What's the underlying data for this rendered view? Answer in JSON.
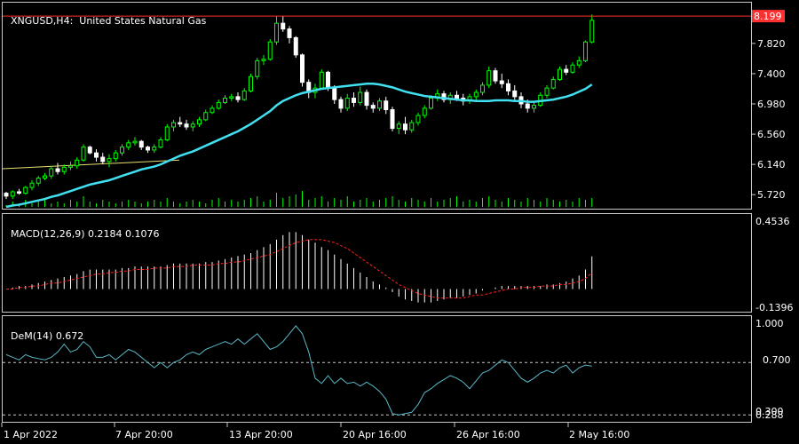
{
  "colors": {
    "background": "#000000",
    "frame": "#c8c8c8",
    "bull_candle": "#00ff00",
    "bear_candle": "#ffffff",
    "moving_average": "#40e0f0",
    "trendline": "#e8e070",
    "price_line": "#ff3030",
    "macd_signal": "#ff2020",
    "dem_line": "#5bb8c8",
    "level_lines": "#c8c8c8"
  },
  "main": {
    "symbol": "XNGUSD",
    "timeframe": "H4",
    "description": "United States Natural Gas",
    "current_price": "8.199",
    "price_ticks": [
      "7.820",
      "7.400",
      "6.980",
      "6.560",
      "6.140",
      "5.720"
    ]
  },
  "macd": {
    "name": "MACD(12,26,9)",
    "value_main": "0.2184",
    "value_signal": "0.1076",
    "scale_max": "0.4536",
    "scale_min": "-0.1396"
  },
  "dem": {
    "name": "DeM(14)",
    "value": "0.672",
    "scale_max": "1.000",
    "level_high": "0.700",
    "level_low": "0.300",
    "scale_min": "0.288"
  },
  "time_axis": [
    "1 Apr 2022",
    "7 Apr 20:00",
    "13 Apr 20:00",
    "20 Apr 16:00",
    "26 Apr 16:00",
    "2 May 16:00"
  ],
  "chart_data": [
    {
      "type": "candlestick",
      "title": "XNGUSD,H4: United States Natural Gas",
      "ylim": [
        5.55,
        8.25
      ],
      "candles": [
        [
          5.74,
          5.76,
          5.66,
          5.7
        ],
        [
          5.7,
          5.78,
          5.66,
          5.76
        ],
        [
          5.76,
          5.8,
          5.72,
          5.74
        ],
        [
          5.74,
          5.84,
          5.72,
          5.82
        ],
        [
          5.82,
          5.92,
          5.78,
          5.88
        ],
        [
          5.88,
          5.98,
          5.84,
          5.95
        ],
        [
          5.95,
          6.02,
          5.92,
          5.98
        ],
        [
          5.98,
          6.12,
          5.94,
          6.08
        ],
        [
          6.08,
          6.16,
          6.0,
          6.04
        ],
        [
          6.04,
          6.14,
          6.0,
          6.1
        ],
        [
          6.1,
          6.18,
          6.06,
          6.12
        ],
        [
          6.12,
          6.24,
          6.08,
          6.2
        ],
        [
          6.2,
          6.42,
          6.18,
          6.38
        ],
        [
          6.38,
          6.4,
          6.28,
          6.3
        ],
        [
          6.3,
          6.35,
          6.18,
          6.24
        ],
        [
          6.24,
          6.3,
          6.14,
          6.18
        ],
        [
          6.18,
          6.28,
          6.1,
          6.22
        ],
        [
          6.22,
          6.34,
          6.18,
          6.3
        ],
        [
          6.3,
          6.42,
          6.26,
          6.38
        ],
        [
          6.38,
          6.48,
          6.34,
          6.44
        ],
        [
          6.44,
          6.52,
          6.4,
          6.46
        ],
        [
          6.46,
          6.48,
          6.34,
          6.38
        ],
        [
          6.38,
          6.4,
          6.3,
          6.34
        ],
        [
          6.34,
          6.42,
          6.3,
          6.38
        ],
        [
          6.38,
          6.52,
          6.36,
          6.48
        ],
        [
          6.48,
          6.7,
          6.46,
          6.66
        ],
        [
          6.66,
          6.76,
          6.6,
          6.72
        ],
        [
          6.72,
          6.8,
          6.66,
          6.7
        ],
        [
          6.7,
          6.76,
          6.62,
          6.66
        ],
        [
          6.66,
          6.74,
          6.6,
          6.7
        ],
        [
          6.7,
          6.8,
          6.66,
          6.76
        ],
        [
          6.76,
          6.9,
          6.74,
          6.86
        ],
        [
          6.86,
          6.96,
          6.84,
          6.92
        ],
        [
          6.92,
          7.04,
          6.9,
          7.0
        ],
        [
          7.0,
          7.1,
          6.98,
          7.06
        ],
        [
          7.06,
          7.12,
          7.02,
          7.08
        ],
        [
          7.08,
          7.14,
          7.0,
          7.04
        ],
        [
          7.04,
          7.2,
          7.02,
          7.16
        ],
        [
          7.16,
          7.4,
          7.14,
          7.36
        ],
        [
          7.36,
          7.62,
          7.32,
          7.58
        ],
        [
          7.58,
          7.66,
          7.52,
          7.6
        ],
        [
          7.6,
          7.88,
          7.58,
          7.84
        ],
        [
          7.84,
          8.2,
          7.8,
          8.1
        ],
        [
          8.1,
          8.2,
          7.98,
          8.02
        ],
        [
          8.02,
          8.06,
          7.82,
          7.9
        ],
        [
          7.9,
          7.92,
          7.62,
          7.66
        ],
        [
          7.66,
          7.68,
          7.22,
          7.28
        ],
        [
          7.28,
          7.32,
          7.06,
          7.14
        ],
        [
          7.14,
          7.26,
          7.06,
          7.2
        ],
        [
          7.2,
          7.46,
          7.18,
          7.42
        ],
        [
          7.42,
          7.44,
          7.16,
          7.2
        ],
        [
          7.2,
          7.24,
          6.98,
          7.04
        ],
        [
          7.04,
          7.08,
          6.86,
          6.92
        ],
        [
          6.92,
          7.12,
          6.88,
          7.06
        ],
        [
          7.06,
          7.14,
          6.94,
          7.0
        ],
        [
          7.0,
          7.22,
          6.96,
          7.14
        ],
        [
          7.14,
          7.18,
          6.9,
          6.96
        ],
        [
          6.96,
          7.0,
          6.86,
          6.92
        ],
        [
          6.92,
          7.06,
          6.88,
          7.02
        ],
        [
          7.02,
          7.08,
          6.84,
          6.9
        ],
        [
          6.9,
          6.94,
          6.6,
          6.64
        ],
        [
          6.64,
          6.74,
          6.56,
          6.7
        ],
        [
          6.7,
          6.8,
          6.56,
          6.62
        ],
        [
          6.62,
          6.76,
          6.58,
          6.72
        ],
        [
          6.72,
          6.86,
          6.68,
          6.82
        ],
        [
          6.82,
          6.96,
          6.78,
          6.92
        ],
        [
          6.92,
          7.1,
          6.9,
          7.06
        ],
        [
          7.06,
          7.18,
          7.02,
          7.12
        ],
        [
          7.12,
          7.16,
          7.0,
          7.04
        ],
        [
          7.04,
          7.14,
          6.98,
          7.1
        ],
        [
          7.1,
          7.16,
          7.02,
          7.06
        ],
        [
          7.06,
          7.12,
          6.96,
          7.02
        ],
        [
          7.02,
          7.12,
          6.98,
          7.08
        ],
        [
          7.08,
          7.18,
          7.02,
          7.14
        ],
        [
          7.14,
          7.28,
          7.1,
          7.24
        ],
        [
          7.24,
          7.5,
          7.2,
          7.44
        ],
        [
          7.44,
          7.48,
          7.26,
          7.3
        ],
        [
          7.3,
          7.4,
          7.2,
          7.26
        ],
        [
          7.26,
          7.32,
          7.1,
          7.16
        ],
        [
          7.16,
          7.24,
          7.02,
          7.08
        ],
        [
          7.08,
          7.14,
          6.92,
          6.98
        ],
        [
          6.98,
          7.04,
          6.86,
          6.92
        ],
        [
          6.92,
          7.02,
          6.86,
          6.96
        ],
        [
          6.96,
          7.14,
          6.94,
          7.1
        ],
        [
          7.1,
          7.24,
          7.06,
          7.2
        ],
        [
          7.2,
          7.36,
          7.18,
          7.32
        ],
        [
          7.32,
          7.5,
          7.3,
          7.46
        ],
        [
          7.46,
          7.52,
          7.38,
          7.42
        ],
        [
          7.42,
          7.56,
          7.4,
          7.52
        ],
        [
          7.52,
          7.64,
          7.48,
          7.58
        ],
        [
          7.58,
          7.86,
          7.56,
          7.84
        ],
        [
          7.84,
          8.22,
          7.82,
          8.14
        ]
      ],
      "moving_average": [
        5.55,
        5.57,
        5.58,
        5.6,
        5.62,
        5.64,
        5.66,
        5.69,
        5.71,
        5.74,
        5.77,
        5.8,
        5.83,
        5.86,
        5.88,
        5.9,
        5.92,
        5.95,
        5.98,
        6.01,
        6.04,
        6.07,
        6.09,
        6.11,
        6.14,
        6.18,
        6.22,
        6.26,
        6.29,
        6.32,
        6.36,
        6.4,
        6.44,
        6.48,
        6.52,
        6.56,
        6.6,
        6.65,
        6.7,
        6.76,
        6.82,
        6.88,
        6.96,
        7.02,
        7.06,
        7.1,
        7.13,
        7.15,
        7.17,
        7.19,
        7.2,
        7.21,
        7.22,
        7.23,
        7.24,
        7.25,
        7.26,
        7.26,
        7.25,
        7.23,
        7.21,
        7.18,
        7.15,
        7.13,
        7.11,
        7.09,
        7.08,
        7.07,
        7.06,
        7.05,
        7.04,
        7.03,
        7.03,
        7.02,
        7.02,
        7.02,
        7.03,
        7.03,
        7.03,
        7.02,
        7.02,
        7.01,
        7.01,
        7.02,
        7.03,
        7.04,
        7.06,
        7.08,
        7.11,
        7.15,
        7.19,
        7.25
      ],
      "trendline": {
        "from": [
          0,
          6.08
        ],
        "to": [
          44,
          6.2
        ]
      },
      "volume_relative": [
        0.1,
        0.3,
        0.2,
        0.4,
        0.2,
        0.3,
        0.5,
        0.2,
        0.3,
        0.2,
        0.4,
        0.3,
        0.6,
        0.3,
        0.2,
        0.4,
        0.3,
        0.2,
        0.3,
        0.4,
        0.3,
        0.2,
        0.3,
        0.4,
        0.3,
        0.5,
        0.3,
        0.2,
        0.3,
        0.4,
        0.3,
        0.2,
        0.4,
        0.5,
        0.3,
        0.4,
        0.3,
        0.4,
        0.5,
        0.6,
        0.3,
        0.4,
        0.8,
        0.5,
        0.6,
        0.7,
        0.9,
        0.4,
        0.5,
        0.6,
        0.3,
        0.5,
        0.4,
        0.6,
        0.3,
        0.4,
        0.5,
        0.3,
        0.4,
        0.5,
        0.6,
        0.4,
        0.3,
        0.5,
        0.4,
        0.3,
        0.5,
        0.3,
        0.4,
        0.5,
        0.6,
        0.3,
        0.4,
        0.3,
        0.5,
        0.6,
        0.4,
        0.3,
        0.5,
        0.4,
        0.3,
        0.5,
        0.4,
        0.3,
        0.5,
        0.4,
        0.3,
        0.4,
        0.3,
        0.5,
        0.4,
        0.5
      ]
    },
    {
      "type": "bar",
      "title": "MACD(12,26,9)",
      "ylim": [
        -0.1396,
        0.4536
      ],
      "histogram": [
        0.0,
        0.01,
        0.02,
        0.02,
        0.03,
        0.04,
        0.05,
        0.06,
        0.07,
        0.08,
        0.09,
        0.1,
        0.12,
        0.13,
        0.13,
        0.13,
        0.13,
        0.13,
        0.14,
        0.14,
        0.15,
        0.15,
        0.15,
        0.15,
        0.15,
        0.16,
        0.17,
        0.17,
        0.17,
        0.17,
        0.17,
        0.18,
        0.18,
        0.19,
        0.2,
        0.21,
        0.22,
        0.23,
        0.24,
        0.26,
        0.28,
        0.3,
        0.33,
        0.36,
        0.38,
        0.38,
        0.36,
        0.33,
        0.31,
        0.28,
        0.26,
        0.23,
        0.2,
        0.17,
        0.14,
        0.11,
        0.08,
        0.05,
        0.03,
        0.01,
        -0.02,
        -0.05,
        -0.07,
        -0.08,
        -0.09,
        -0.09,
        -0.09,
        -0.08,
        -0.07,
        -0.06,
        -0.06,
        -0.05,
        -0.04,
        -0.03,
        -0.01,
        0.0,
        0.01,
        0.02,
        0.02,
        0.02,
        0.02,
        0.02,
        0.02,
        0.02,
        0.03,
        0.03,
        0.04,
        0.05,
        0.07,
        0.09,
        0.13,
        0.2184
      ],
      "signal": [
        0.0,
        0.0,
        0.01,
        0.01,
        0.02,
        0.02,
        0.03,
        0.04,
        0.04,
        0.05,
        0.06,
        0.07,
        0.08,
        0.09,
        0.1,
        0.1,
        0.11,
        0.11,
        0.12,
        0.12,
        0.13,
        0.13,
        0.13,
        0.14,
        0.14,
        0.14,
        0.15,
        0.15,
        0.15,
        0.16,
        0.16,
        0.16,
        0.16,
        0.17,
        0.17,
        0.18,
        0.18,
        0.19,
        0.2,
        0.21,
        0.22,
        0.23,
        0.25,
        0.27,
        0.29,
        0.31,
        0.32,
        0.33,
        0.33,
        0.33,
        0.32,
        0.31,
        0.29,
        0.27,
        0.24,
        0.21,
        0.18,
        0.15,
        0.12,
        0.09,
        0.06,
        0.03,
        0.01,
        -0.01,
        -0.03,
        -0.04,
        -0.05,
        -0.06,
        -0.06,
        -0.06,
        -0.06,
        -0.06,
        -0.05,
        -0.04,
        -0.04,
        -0.03,
        -0.02,
        -0.01,
        0.0,
        0.0,
        0.01,
        0.01,
        0.01,
        0.02,
        0.02,
        0.02,
        0.03,
        0.03,
        0.04,
        0.05,
        0.07,
        0.1076
      ]
    },
    {
      "type": "line",
      "title": "DeM(14)",
      "ylim": [
        0.288,
        1.0
      ],
      "levels": [
        0.7,
        0.3
      ],
      "values": [
        0.76,
        0.74,
        0.72,
        0.76,
        0.74,
        0.73,
        0.72,
        0.74,
        0.78,
        0.84,
        0.78,
        0.8,
        0.86,
        0.82,
        0.74,
        0.74,
        0.76,
        0.72,
        0.76,
        0.8,
        0.78,
        0.74,
        0.7,
        0.66,
        0.7,
        0.66,
        0.7,
        0.72,
        0.76,
        0.78,
        0.76,
        0.8,
        0.82,
        0.84,
        0.86,
        0.84,
        0.88,
        0.84,
        0.88,
        0.92,
        0.86,
        0.8,
        0.82,
        0.86,
        0.92,
        0.98,
        0.92,
        0.78,
        0.58,
        0.54,
        0.6,
        0.54,
        0.58,
        0.54,
        0.55,
        0.52,
        0.55,
        0.52,
        0.48,
        0.42,
        0.31,
        0.3,
        0.31,
        0.32,
        0.38,
        0.47,
        0.5,
        0.54,
        0.57,
        0.6,
        0.58,
        0.55,
        0.5,
        0.56,
        0.62,
        0.64,
        0.68,
        0.72,
        0.7,
        0.64,
        0.58,
        0.55,
        0.58,
        0.62,
        0.64,
        0.62,
        0.66,
        0.68,
        0.62,
        0.66,
        0.68,
        0.672
      ]
    }
  ]
}
